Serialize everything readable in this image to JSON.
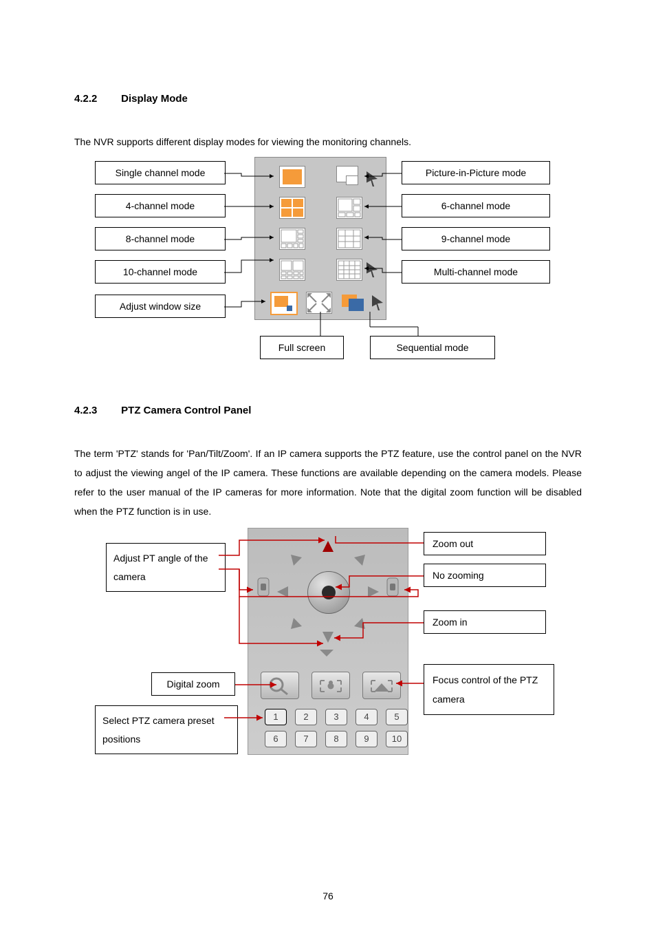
{
  "section1": {
    "number": "4.2.2",
    "title": "Display Mode",
    "intro": "The NVR supports different display modes for viewing the monitoring channels.",
    "labels": {
      "single_channel": "Single channel mode",
      "four_channel": "4-channel mode",
      "six_channel": "6-channel mode",
      "eight_channel": "8-channel mode",
      "nine_channel": "9-channel mode",
      "ten_channel": "10-channel mode",
      "multi_channel": "Multi-channel mode",
      "pip": "Picture-in-Picture mode",
      "adjust_window": "Adjust window size",
      "full_screen": "Full screen",
      "sequential": "Sequential mode"
    }
  },
  "section2": {
    "number": "4.2.3",
    "title": "PTZ Camera Control Panel",
    "para": "The term 'PTZ' stands for 'Pan/Tilt/Zoom'.   If an IP camera supports the PTZ feature, use the control panel on the NVR to adjust the viewing angel of the IP camera.   These functions are available depending on the camera models.   Please refer to the user manual of the IP cameras for more information.   Note that the digital zoom function will be disabled when the PTZ function is in use.",
    "labels": {
      "adjust_pt": "Adjust PT angle of the camera",
      "digital_zoom": "Digital zoom",
      "select_preset": "Select PTZ camera preset positions",
      "zoom_out": "Zoom out",
      "no_zoom": "No zooming",
      "zoom_in": "Zoom in",
      "focus": "Focus control of the PTZ camera"
    },
    "presets_row1": [
      "1",
      "2",
      "3",
      "4",
      "5"
    ],
    "presets_row2": [
      "6",
      "7",
      "8",
      "9",
      "10"
    ]
  },
  "page_number": "76"
}
